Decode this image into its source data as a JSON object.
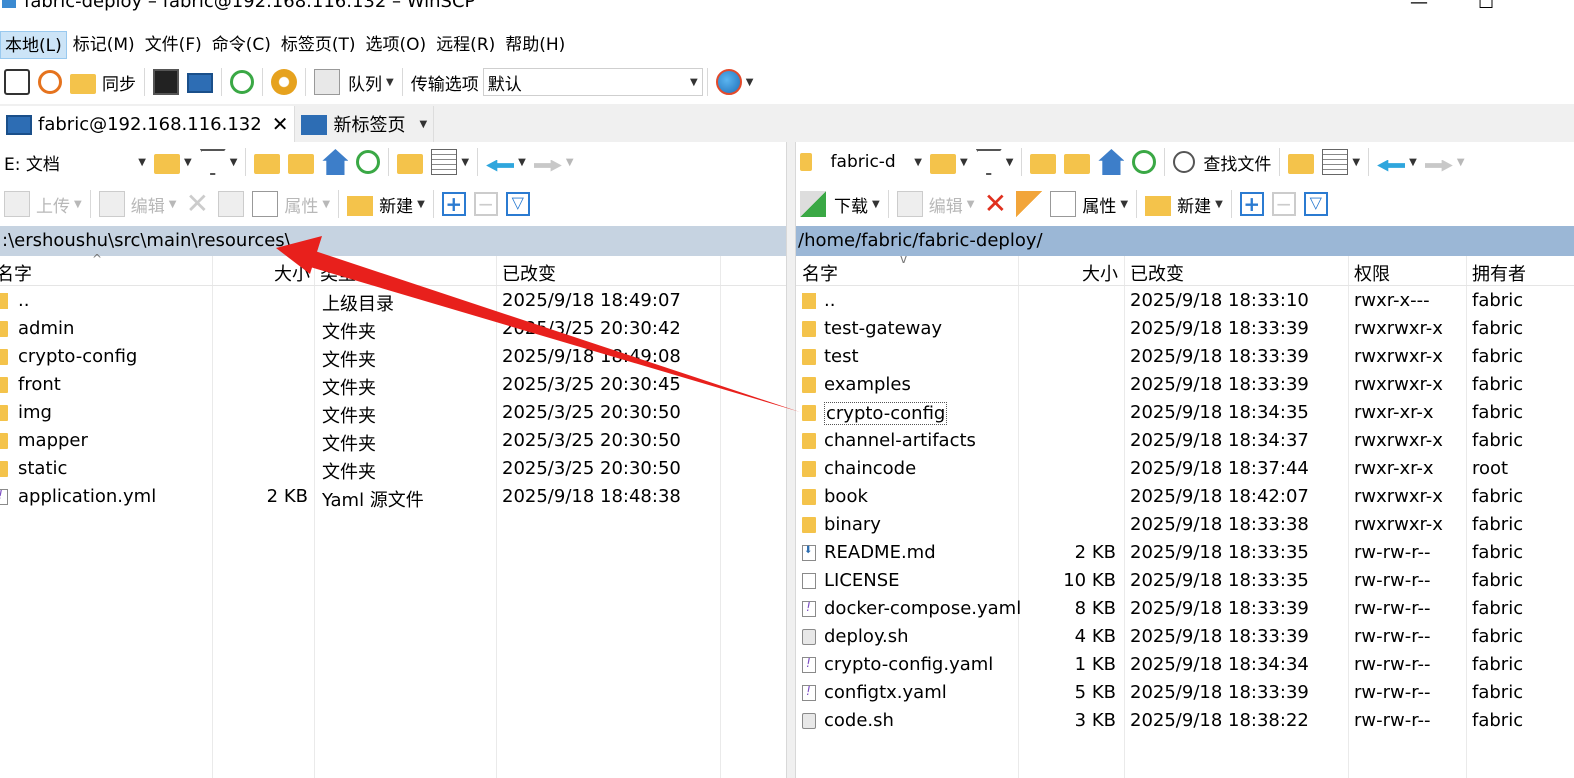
{
  "window": {
    "title": "fabric-deploy – fabric@192.168.116.132 – WinSCP",
    "minimize": "—",
    "maximize": "☐"
  },
  "menu": [
    "本地(L)",
    "标记(M)",
    "文件(F)",
    "命令(C)",
    "标签页(T)",
    "选项(O)",
    "远程(R)",
    "帮助(H)"
  ],
  "toolbar": {
    "sync_label": "同步",
    "queue_label": "队列",
    "transfer_label": "传输选项",
    "transfer_value": "默认"
  },
  "tabs": {
    "session": "fabric@192.168.116.132",
    "close": "✕",
    "new_tab": "新标签页"
  },
  "left": {
    "drive": "E: 文档",
    "upload": "上传",
    "edit": "编辑",
    "properties": "属性",
    "new": "新建",
    "path": ":\\ershoushu\\src\\main\\resources\\",
    "headers": {
      "name": "名字",
      "size": "大小",
      "type": "类型",
      "changed": "已改变"
    },
    "files": [
      {
        "name": "..",
        "size": "",
        "type": "上级目录",
        "changed": "2025/9/18 18:49:07",
        "icon": "parent"
      },
      {
        "name": "admin",
        "size": "",
        "type": "文件夹",
        "changed": "2025/3/25 20:30:42",
        "icon": "folder"
      },
      {
        "name": "crypto-config",
        "size": "",
        "type": "文件夹",
        "changed": "2025/9/18 18:49:08",
        "icon": "folder"
      },
      {
        "name": "front",
        "size": "",
        "type": "文件夹",
        "changed": "2025/3/25 20:30:45",
        "icon": "folder"
      },
      {
        "name": "img",
        "size": "",
        "type": "文件夹",
        "changed": "2025/3/25 20:30:50",
        "icon": "folder"
      },
      {
        "name": "mapper",
        "size": "",
        "type": "文件夹",
        "changed": "2025/3/25 20:30:50",
        "icon": "folder"
      },
      {
        "name": "static",
        "size": "",
        "type": "文件夹",
        "changed": "2025/3/25 20:30:50",
        "icon": "folder"
      },
      {
        "name": "application.yml",
        "size": "2 KB",
        "type": "Yaml 源文件",
        "changed": "2025/9/18 18:48:38",
        "icon": "yaml"
      }
    ]
  },
  "right": {
    "folder_combo": "fabric-d",
    "download": "下载",
    "edit": "编辑",
    "properties": "属性",
    "new": "新建",
    "find": "查找文件",
    "path": "/home/fabric/fabric-deploy/",
    "headers": {
      "name": "名字",
      "size": "大小",
      "changed": "已改变",
      "rights": "权限",
      "owner": "拥有者"
    },
    "files": [
      {
        "name": "..",
        "size": "",
        "changed": "2025/9/18 18:33:10",
        "rights": "rwxr-x---",
        "owner": "fabric",
        "icon": "parent"
      },
      {
        "name": "test-gateway",
        "size": "",
        "changed": "2025/9/18 18:33:39",
        "rights": "rwxrwxr-x",
        "owner": "fabric",
        "icon": "folder"
      },
      {
        "name": "test",
        "size": "",
        "changed": "2025/9/18 18:33:39",
        "rights": "rwxrwxr-x",
        "owner": "fabric",
        "icon": "folder"
      },
      {
        "name": "examples",
        "size": "",
        "changed": "2025/9/18 18:33:39",
        "rights": "rwxrwxr-x",
        "owner": "fabric",
        "icon": "folder"
      },
      {
        "name": "crypto-config",
        "size": "",
        "changed": "2025/9/18 18:34:35",
        "rights": "rwxr-xr-x",
        "owner": "fabric",
        "icon": "folder"
      },
      {
        "name": "channel-artifacts",
        "size": "",
        "changed": "2025/9/18 18:34:37",
        "rights": "rwxrwxr-x",
        "owner": "fabric",
        "icon": "folder"
      },
      {
        "name": "chaincode",
        "size": "",
        "changed": "2025/9/18 18:37:44",
        "rights": "rwxr-xr-x",
        "owner": "root",
        "icon": "folder"
      },
      {
        "name": "book",
        "size": "",
        "changed": "2025/9/18 18:42:07",
        "rights": "rwxrwxr-x",
        "owner": "fabric",
        "icon": "folder"
      },
      {
        "name": "binary",
        "size": "",
        "changed": "2025/9/18 18:33:38",
        "rights": "rwxrwxr-x",
        "owner": "fabric",
        "icon": "folder"
      },
      {
        "name": "README.md",
        "size": "2 KB",
        "changed": "2025/9/18 18:33:35",
        "rights": "rw-rw-r--",
        "owner": "fabric",
        "icon": "md"
      },
      {
        "name": "LICENSE",
        "size": "10 KB",
        "changed": "2025/9/18 18:33:35",
        "rights": "rw-rw-r--",
        "owner": "fabric",
        "icon": "file"
      },
      {
        "name": "docker-compose.yaml",
        "size": "8 KB",
        "changed": "2025/9/18 18:33:39",
        "rights": "rw-rw-r--",
        "owner": "fabric",
        "icon": "yaml"
      },
      {
        "name": "deploy.sh",
        "size": "4 KB",
        "changed": "2025/9/18 18:33:39",
        "rights": "rw-rw-r--",
        "owner": "fabric",
        "icon": "sh"
      },
      {
        "name": "crypto-config.yaml",
        "size": "1 KB",
        "changed": "2025/9/18 18:34:34",
        "rights": "rw-rw-r--",
        "owner": "fabric",
        "icon": "yaml"
      },
      {
        "name": "configtx.yaml",
        "size": "5 KB",
        "changed": "2025/9/18 18:33:39",
        "rights": "rw-rw-r--",
        "owner": "fabric",
        "icon": "yaml"
      },
      {
        "name": "code.sh",
        "size": "3 KB",
        "changed": "2025/9/18 18:38:22",
        "rights": "rw-rw-r--",
        "owner": "fabric",
        "icon": "sh"
      }
    ]
  },
  "colors": {
    "left_path_bg": "#c6d3e1",
    "right_path_bg": "#9bb7d6",
    "annotation_arrow": "#e8201c"
  },
  "icons": {
    "upload": "upload-icon",
    "download": "download-icon",
    "delete": "delete-icon",
    "rename": "rename-icon",
    "properties": "properties-icon",
    "new": "new-folder-icon",
    "home": "home-icon",
    "refresh": "refresh-icon",
    "back": "back-arrow-icon",
    "forward": "forward-arrow-icon"
  }
}
